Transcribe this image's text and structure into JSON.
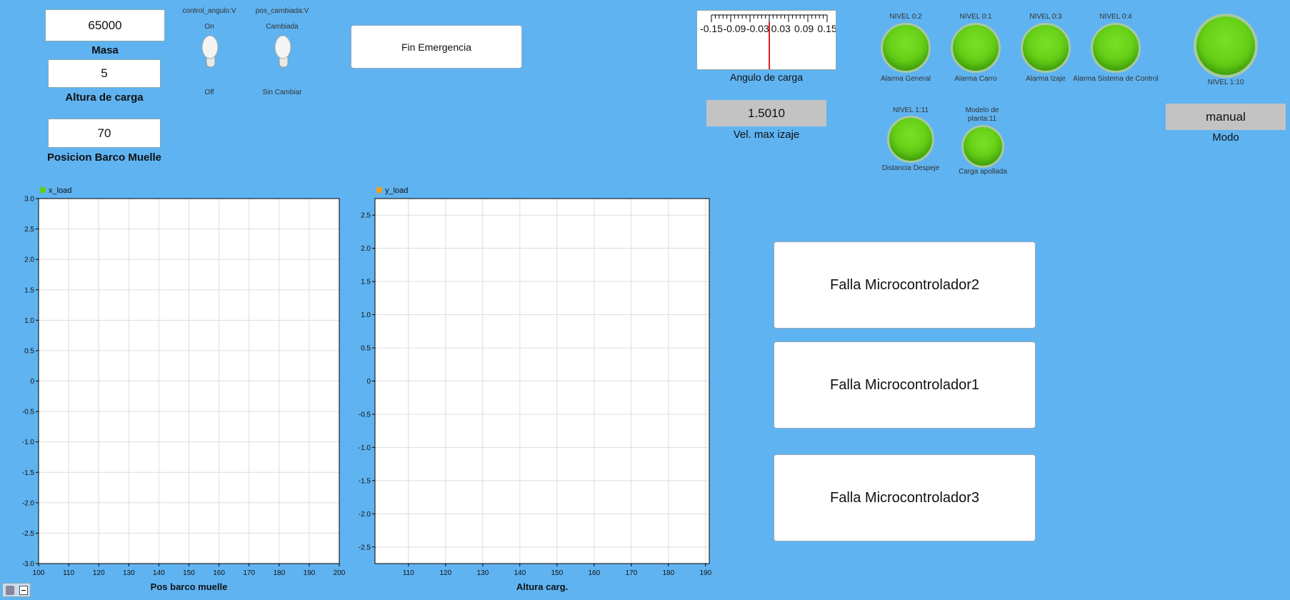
{
  "inputs": {
    "masa": {
      "value": "65000",
      "label": "Masa"
    },
    "altura": {
      "value": "5",
      "label": "Altura de carga"
    },
    "posicion": {
      "value": "70",
      "label": "Posicion Barco Muelle"
    }
  },
  "switches": [
    {
      "title": "control_angulo:V",
      "on": "On",
      "off": "Off"
    },
    {
      "title": "pos_cambiada:V",
      "on": "Cambiada",
      "off": "Sin Cambiar"
    }
  ],
  "emergency_button": "Fin Emergencia",
  "gauge": {
    "ticks": [
      "-0.15",
      "-0.09",
      "-0.03",
      "0.03",
      "0.09",
      "0.15"
    ],
    "label": "Angulo de carga",
    "value": 0
  },
  "vel_max": {
    "value": "1.5010",
    "label": "Vel. max izaje"
  },
  "alarms_top": [
    {
      "level": "NIVEL 0:2",
      "label": "Alarma General"
    },
    {
      "level": "NIVEL 0:1",
      "label": "Alarma Carro"
    },
    {
      "level": "NIVEL 0:3",
      "label": "Alarma Izaje"
    },
    {
      "level": "NIVEL 0:4",
      "label": "Alarma Sistema de Control"
    }
  ],
  "alarms_bottom": [
    {
      "level": "NIVEL 1:11",
      "label": "Distancia Despeje"
    },
    {
      "level": "Modelo de planta:11",
      "label": "Carga apollada"
    }
  ],
  "main_led": {
    "level": "NIVEL 1:10"
  },
  "modo": {
    "value": "manual",
    "label": "Modo"
  },
  "fault_buttons": [
    "Falla Microcontrolador2",
    "Falla Microcontrolador1",
    "Falla Microcontrolador3"
  ],
  "colors": {
    "background": "#5fb3f1",
    "led": "#62cc14",
    "series_x": "#62cc14",
    "series_y": "#f0a020",
    "needle": "#e02020"
  },
  "chart_data": [
    {
      "type": "line",
      "legend": "x_load",
      "xlabel": "Pos barco muelle",
      "xlim": [
        100,
        200
      ],
      "ylim": [
        -3.0,
        3.0
      ],
      "xticks": [
        "100",
        "110",
        "120",
        "130",
        "140",
        "150",
        "160",
        "170",
        "180",
        "190",
        "200"
      ],
      "yticks": [
        "3.0",
        "2.5",
        "2.0",
        "1.5",
        "1.0",
        "0.5",
        "0",
        "-0.5",
        "-1.0",
        "-1.5",
        "-2.0",
        "-2.5",
        "-3.0"
      ],
      "series": []
    },
    {
      "type": "line",
      "legend": "y_load",
      "xlabel": "Altura carg.",
      "xlim": [
        101,
        191
      ],
      "ylim": [
        -2.75,
        2.75
      ],
      "xticks": [
        "110",
        "120",
        "130",
        "140",
        "150",
        "160",
        "170",
        "180",
        "190"
      ],
      "yticks": [
        "2.5",
        "2.0",
        "1.5",
        "1.0",
        "0.5",
        "0",
        "-0.5",
        "-1.0",
        "-1.5",
        "-2.0",
        "-2.5"
      ],
      "series": []
    }
  ]
}
